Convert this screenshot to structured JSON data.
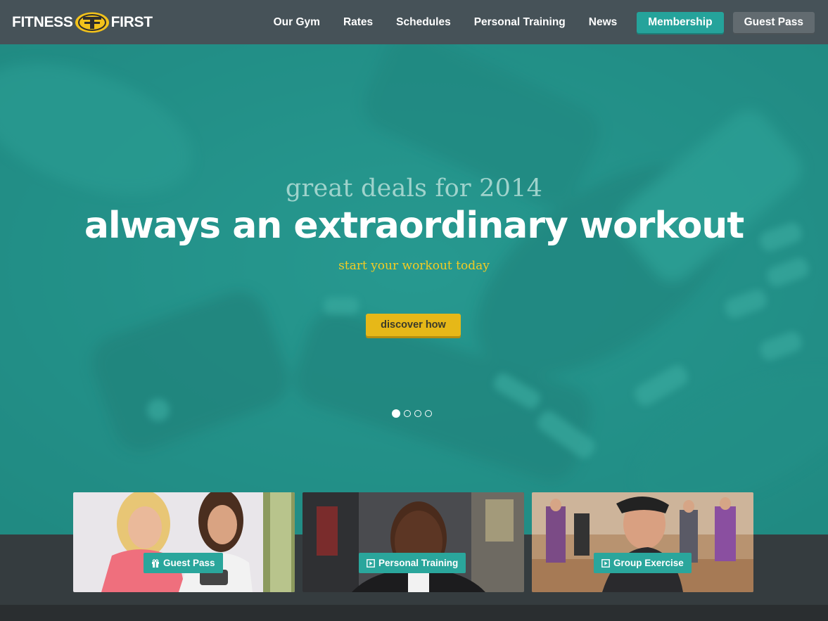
{
  "brand": {
    "left": "FITNESS",
    "right": "FIRST",
    "colors": {
      "yellow": "#f2c21b",
      "dark": "#2e2e2e"
    }
  },
  "nav": {
    "items": [
      "Our Gym",
      "Rates",
      "Schedules",
      "Personal Training",
      "News"
    ],
    "membership_label": "Membership",
    "guest_pass_label": "Guest Pass"
  },
  "hero": {
    "kicker": "great deals for 2014",
    "title": "always an extraordinary workout",
    "subtitle": "start your workout today",
    "cta": "discover how",
    "slides_total": 4,
    "slide_active": 1
  },
  "cards": [
    {
      "label": "Guest Pass",
      "icon": "gift-icon"
    },
    {
      "label": "Personal Training",
      "icon": "play-icon"
    },
    {
      "label": "Group Exercise",
      "icon": "play-icon"
    }
  ],
  "colors": {
    "teal": "#25a39b",
    "header": "#465258",
    "accent_yellow": "#e6b818"
  }
}
